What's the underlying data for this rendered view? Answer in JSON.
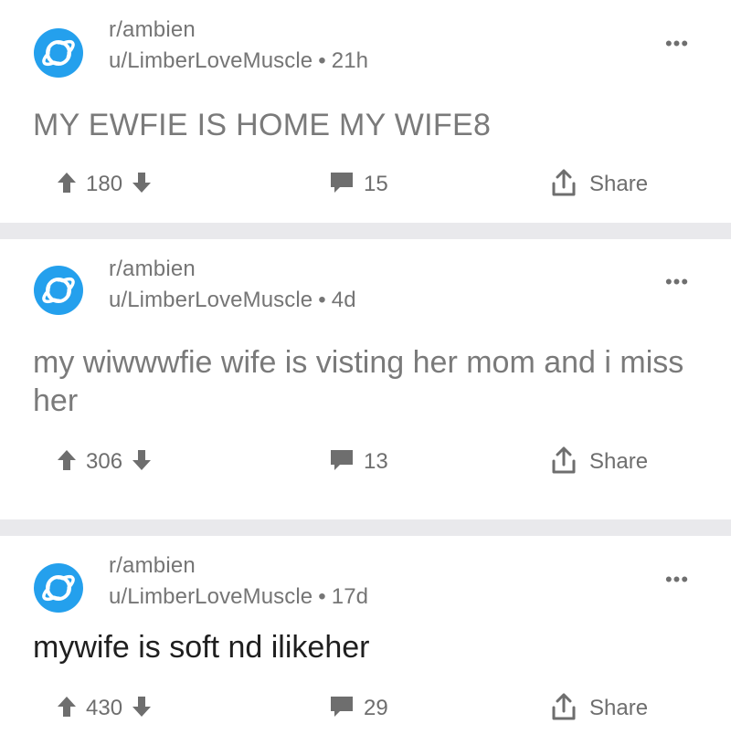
{
  "posts": [
    {
      "subreddit": "r/ambien",
      "author": "u/LimberLoveMuscle",
      "age": "21h",
      "title": "MY EWFIE IS HOME MY WIFE8",
      "votes": "180",
      "comments": "15",
      "share_label": "Share"
    },
    {
      "subreddit": "r/ambien",
      "author": "u/LimberLoveMuscle",
      "age": "4d",
      "title": "my wiwwwfie wife is visting her mom and i miss her",
      "votes": "306",
      "comments": "13",
      "share_label": "Share"
    },
    {
      "subreddit": "r/ambien",
      "author": "u/LimberLoveMuscle",
      "age": "17d",
      "title": "mywife is soft nd ilikeher",
      "votes": "430",
      "comments": "29",
      "share_label": "Share"
    }
  ],
  "icons": {
    "avatar": "planet-icon",
    "overflow": "more-dots-icon",
    "upvote": "arrow-up-icon",
    "downvote": "arrow-down-icon",
    "comment": "comment-bubble-icon",
    "share": "share-icon"
  },
  "colors": {
    "avatar_bg": "#24a0ed",
    "separator": "#e9e9ec",
    "text_meta": "#757575"
  }
}
